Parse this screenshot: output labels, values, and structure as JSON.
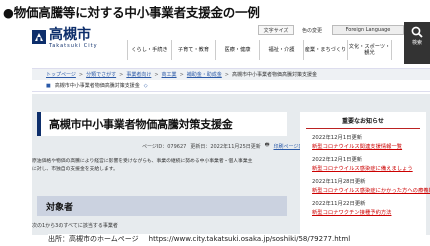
{
  "slide": {
    "title": "●物価高騰等に対する中小事業者支援金の一例"
  },
  "header": {
    "logo_ja": "高槻市",
    "logo_en": "Takatsuki City",
    "zoom_label": "文字サイズ",
    "color_label": "色の変更",
    "lang_label": "Foreign Language",
    "search_label": "検索"
  },
  "gnav": {
    "items": [
      {
        "label": "くらし・手続き"
      },
      {
        "label": "子育て・教育"
      },
      {
        "label": "医療・健康"
      },
      {
        "label": "福祉・介護"
      },
      {
        "label": "産業・まちづくり"
      },
      {
        "label": "文化・スポーツ・観光"
      }
    ]
  },
  "breadcrumb": {
    "items": [
      {
        "label": "トップページ"
      },
      {
        "label": "分類でさがす"
      },
      {
        "label": "事業者向け"
      },
      {
        "label": "商工業"
      },
      {
        "label": "補助金・助成金"
      }
    ],
    "current": "高槻市中小事業者物価高騰対策支援金"
  },
  "current_location": {
    "text": "高槻市中小事業者物価高騰対策支援金"
  },
  "main": {
    "page_title": "高槻市中小事業者物価高騰対策支援金",
    "page_id": "ページID：079627",
    "updated": "更新日：2022年11月25日更新",
    "print_label": "印刷ページ表示",
    "description_lines": [
      "原油価格や物価の高騰により経営に影響を受けながらも、事業の継続に努める中小事業者・個人事業主",
      "に対し、市独自の支援金を支給します。"
    ],
    "section_title": "対象者",
    "target_text": "次の1から3のすべてに該当する事業者"
  },
  "sidebar": {
    "title": "重要なお知らせ",
    "items": [
      {
        "date": "2022年12月1日更新",
        "link": "新型コロナウイルス関連支援情報一覧"
      },
      {
        "date": "2022年12月1日更新",
        "link": "新型コロナウイルス感染症に備えましょう"
      },
      {
        "date": "2022年11月28日更新",
        "link": "新型コロナウイルス感染症にかかった方への療養期間"
      },
      {
        "date": "2022年11月22日更新",
        "link": "新型コロナワクチン接種予約方法"
      }
    ]
  },
  "source": {
    "label": "出所：高槻市のホームページ",
    "url": "https://www.city.takatsuki.osaka.jp/soshiki/58/79277.html"
  },
  "colors": {
    "brand_navy": "#0d2e6b",
    "link_blue": "#2b5aa8",
    "alert_red": "#cc0000",
    "breadcrumb_bg": "#eef1f4",
    "main_bg": "#e7ebee",
    "section_bg": "#cbd2e0"
  },
  "icons": [
    "logo-mark-icon",
    "search-icon",
    "pin-icon",
    "print-icon",
    "current-page-icon"
  ]
}
